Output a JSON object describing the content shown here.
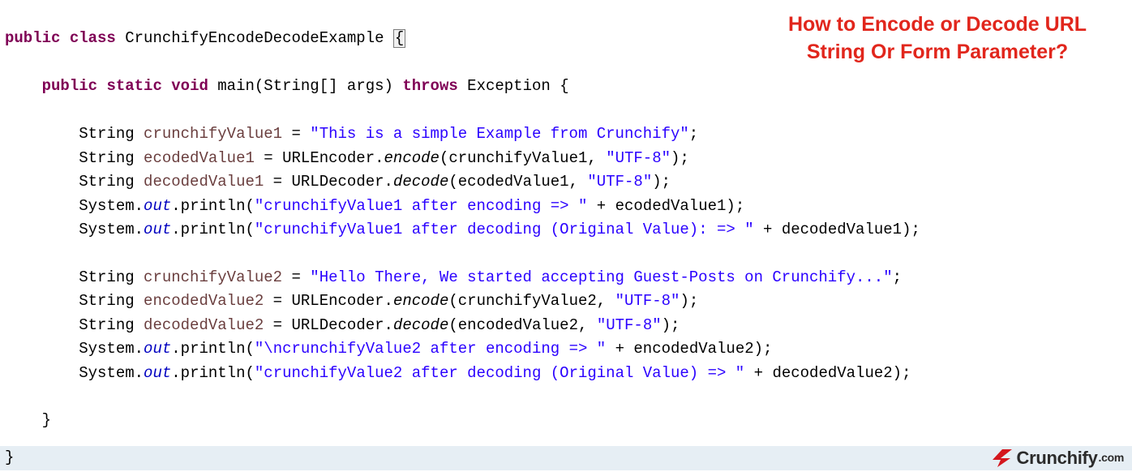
{
  "title": {
    "line1": "How to Encode or Decode URL",
    "line2": "String Or Form Parameter?"
  },
  "code": {
    "kw_public": "public",
    "kw_class": "class",
    "kw_static": "static",
    "kw_void": "void",
    "kw_throws": "throws",
    "cls_name": "CrunchifyEncodeDecodeExample",
    "main": "main",
    "string_arr": "String[]",
    "args": "args",
    "exception": "Exception",
    "String": "String",
    "System": "System",
    "out": "out",
    "println": "println",
    "URLEncoder": "URLEncoder",
    "URLDecoder": "URLDecoder",
    "encode": "encode",
    "decode": "decode",
    "var_cv1": "crunchifyValue1",
    "var_ev1": "ecodedValue1",
    "var_dv1": "decodedValue1",
    "var_cv2": "crunchifyValue2",
    "var_ev2": "encodedValue2",
    "var_dv2": "decodedValue2",
    "str_cv1": "\"This is a simple Example from Crunchify\"",
    "str_utf8": "\"UTF-8\"",
    "str_p1": "\"crunchifyValue1 after encoding => \"",
    "str_p2": "\"crunchifyValue1 after decoding (Original Value): => \"",
    "str_cv2": "\"Hello There, We started accepting Guest-Posts on Crunchify...\"",
    "str_p3": "\"\\ncrunchifyValue2 after encoding => \"",
    "str_p4": "\"crunchifyValue2 after decoding (Original Value) => \"",
    "brace_open": "{",
    "brace_close": "}",
    "eq": " = ",
    "plus": " + ",
    "semi": ";",
    "dot": ".",
    "comma_sp": ", ",
    "lp": "(",
    "rp": ")"
  },
  "logo": {
    "name": "Crunchify",
    "dotcom": ".com"
  }
}
